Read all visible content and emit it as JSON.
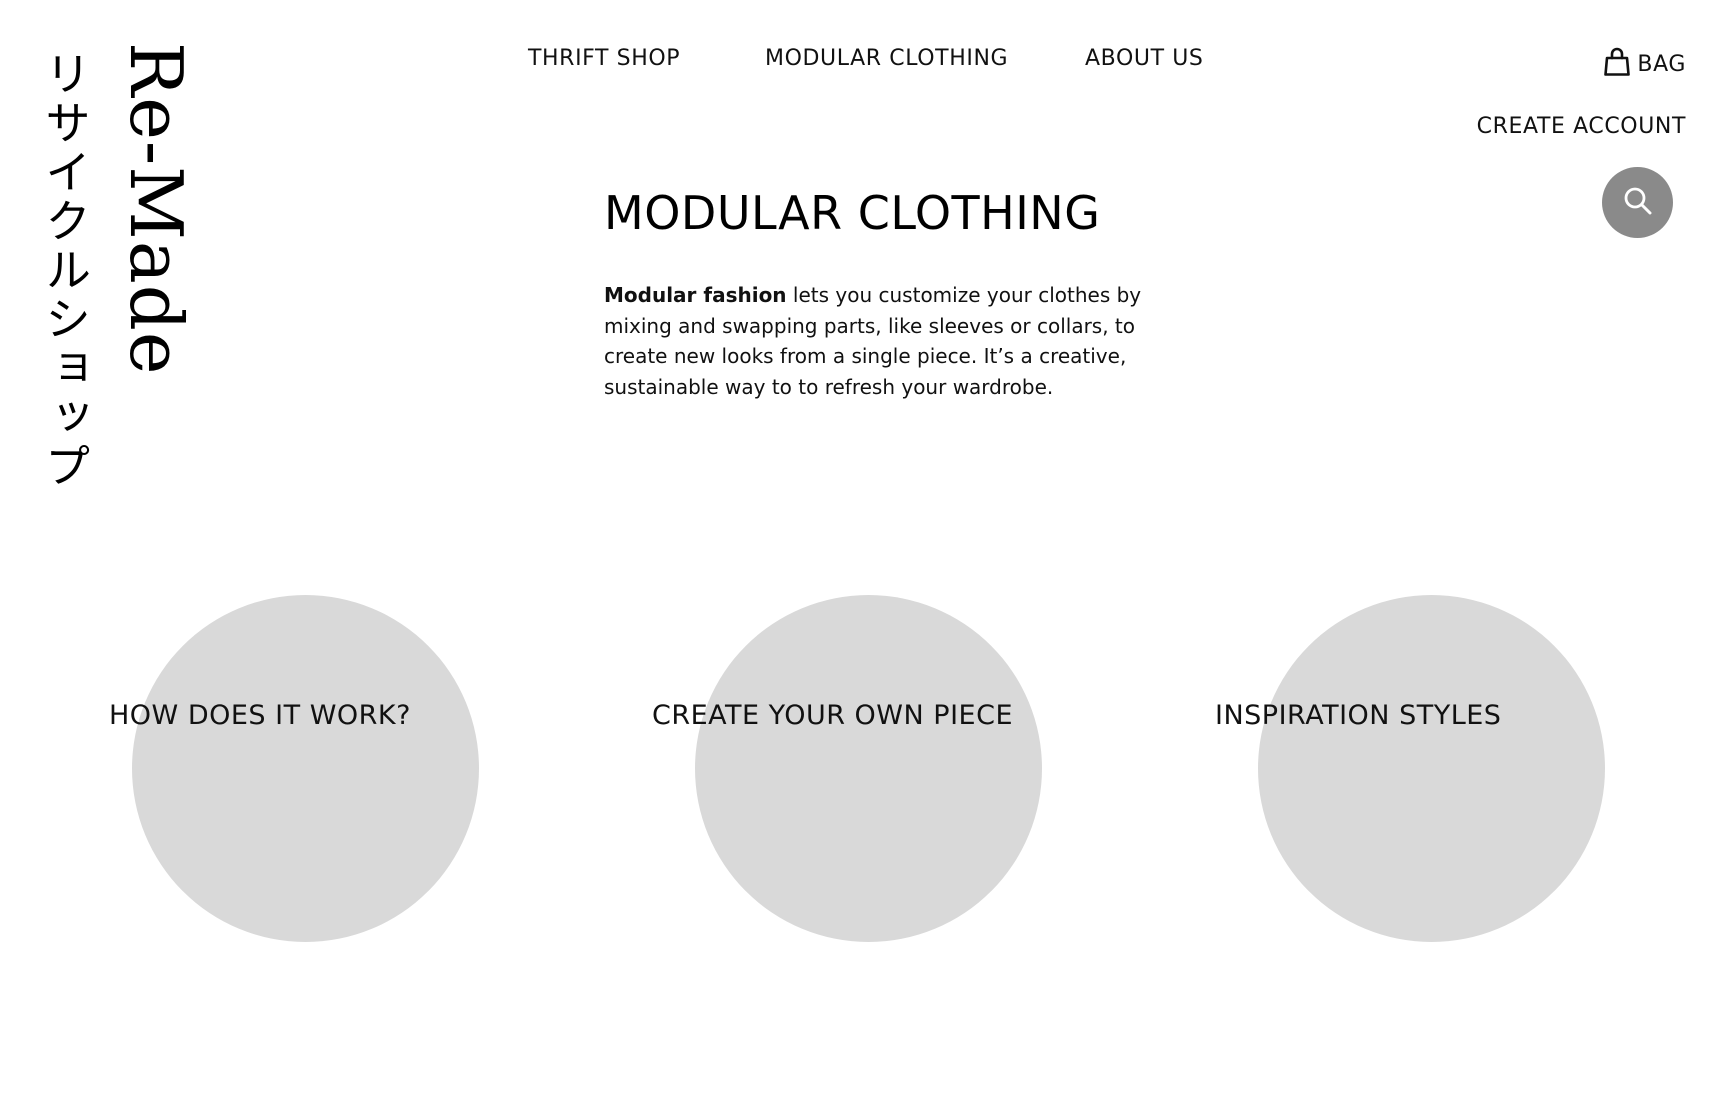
{
  "brand": {
    "name": "Re-Made",
    "japanese": "リサイクルショップ"
  },
  "nav": {
    "items": [
      {
        "label": "THRIFT SHOP"
      },
      {
        "label": "MODULAR CLOTHING"
      },
      {
        "label": "ABOUT US"
      }
    ]
  },
  "utility": {
    "bag_label": "BAG",
    "bag_icon": "shopping-bag-icon",
    "create_account_label": "CREATE ACCOUNT",
    "search_icon": "search-icon",
    "search_button_color": "#8a8a8a"
  },
  "main": {
    "title": "MODULAR CLOTHING",
    "intro_bold": "Modular fashion",
    "intro_rest": " lets you customize your clothes by mixing and swapping parts, like sleeves or collars, to create new looks from a single piece. It’s a creative, sustainable way to to refresh your wardrobe."
  },
  "cards": [
    {
      "label": "HOW DOES IT WORK?"
    },
    {
      "label": "CREATE YOUR OWN PIECE"
    },
    {
      "label": "INSPIRATION STYLES"
    }
  ],
  "colors": {
    "circle": "#d9d9d9",
    "text": "#111111",
    "background": "#ffffff"
  }
}
